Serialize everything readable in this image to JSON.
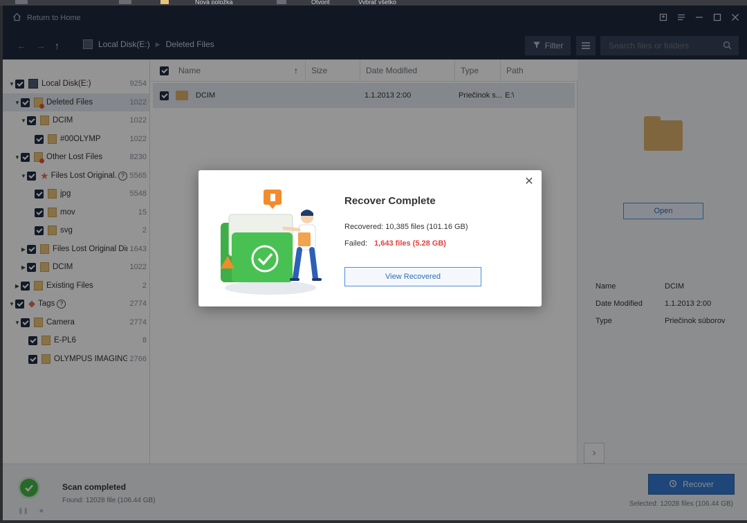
{
  "taskbar": {
    "items": [
      "Nová položka",
      "Otvoriť",
      "Vybrať všetko"
    ]
  },
  "titlebar": {
    "home_label": "Return to Home"
  },
  "navbar": {
    "breadcrumb": [
      "Local Disk(E:)",
      "Deleted Files"
    ],
    "filter_label": "Filter",
    "search_placeholder": "Search files or folders"
  },
  "tree": [
    {
      "label": "Local Disk(E:)",
      "count": "9254"
    },
    {
      "label": "Deleted Files",
      "count": "1022"
    },
    {
      "label": "DCIM",
      "count": "1022"
    },
    {
      "label": "#00OLYMP",
      "count": "1022"
    },
    {
      "label": "Other Lost Files",
      "count": "8230"
    },
    {
      "label": "Files Lost Original...",
      "count": "5565"
    },
    {
      "label": "jpg",
      "count": "5548"
    },
    {
      "label": "mov",
      "count": "15"
    },
    {
      "label": "svg",
      "count": "2"
    },
    {
      "label": "Files Lost Original Dir...",
      "count": "1643"
    },
    {
      "label": "DCIM",
      "count": "1022"
    },
    {
      "label": "Existing Files",
      "count": "2"
    },
    {
      "label": "Tags",
      "count": "2774"
    },
    {
      "label": "Camera",
      "count": "2774"
    },
    {
      "label": "E-PL6",
      "count": "8"
    },
    {
      "label": "OLYMPUS IMAGING C...",
      "count": "2766"
    }
  ],
  "table": {
    "columns": [
      "Name",
      "Size",
      "Date Modified",
      "Type",
      "Path"
    ],
    "rows": [
      {
        "name": "DCIM",
        "size": "",
        "date": "1.1.2013 2:00",
        "type": "Priečinok s...",
        "path": "E:\\"
      }
    ]
  },
  "preview": {
    "open_label": "Open",
    "props": [
      {
        "key": "Name",
        "value": "DCIM"
      },
      {
        "key": "Date Modified",
        "value": "1.1.2013 2:00"
      },
      {
        "key": "Type",
        "value": "Priečinok súborov"
      }
    ]
  },
  "status": {
    "title": "Scan completed",
    "found": "Found: 12028 file (106.44 GB)",
    "recover_label": "Recover",
    "selected": "Selected: 12028 files (106.44 GB)"
  },
  "dialog": {
    "title": "Recover Complete",
    "recovered": "Recovered: 10,385 files (101.16 GB)",
    "failed_label": "Failed:",
    "failed_value": "1,643 files (5.28 GB)",
    "view_label": "View Recovered"
  },
  "colors": {
    "titlebar": "#1e2a3d",
    "accent": "#3679cf",
    "failed": "#e2403f",
    "success": "#45b649"
  }
}
